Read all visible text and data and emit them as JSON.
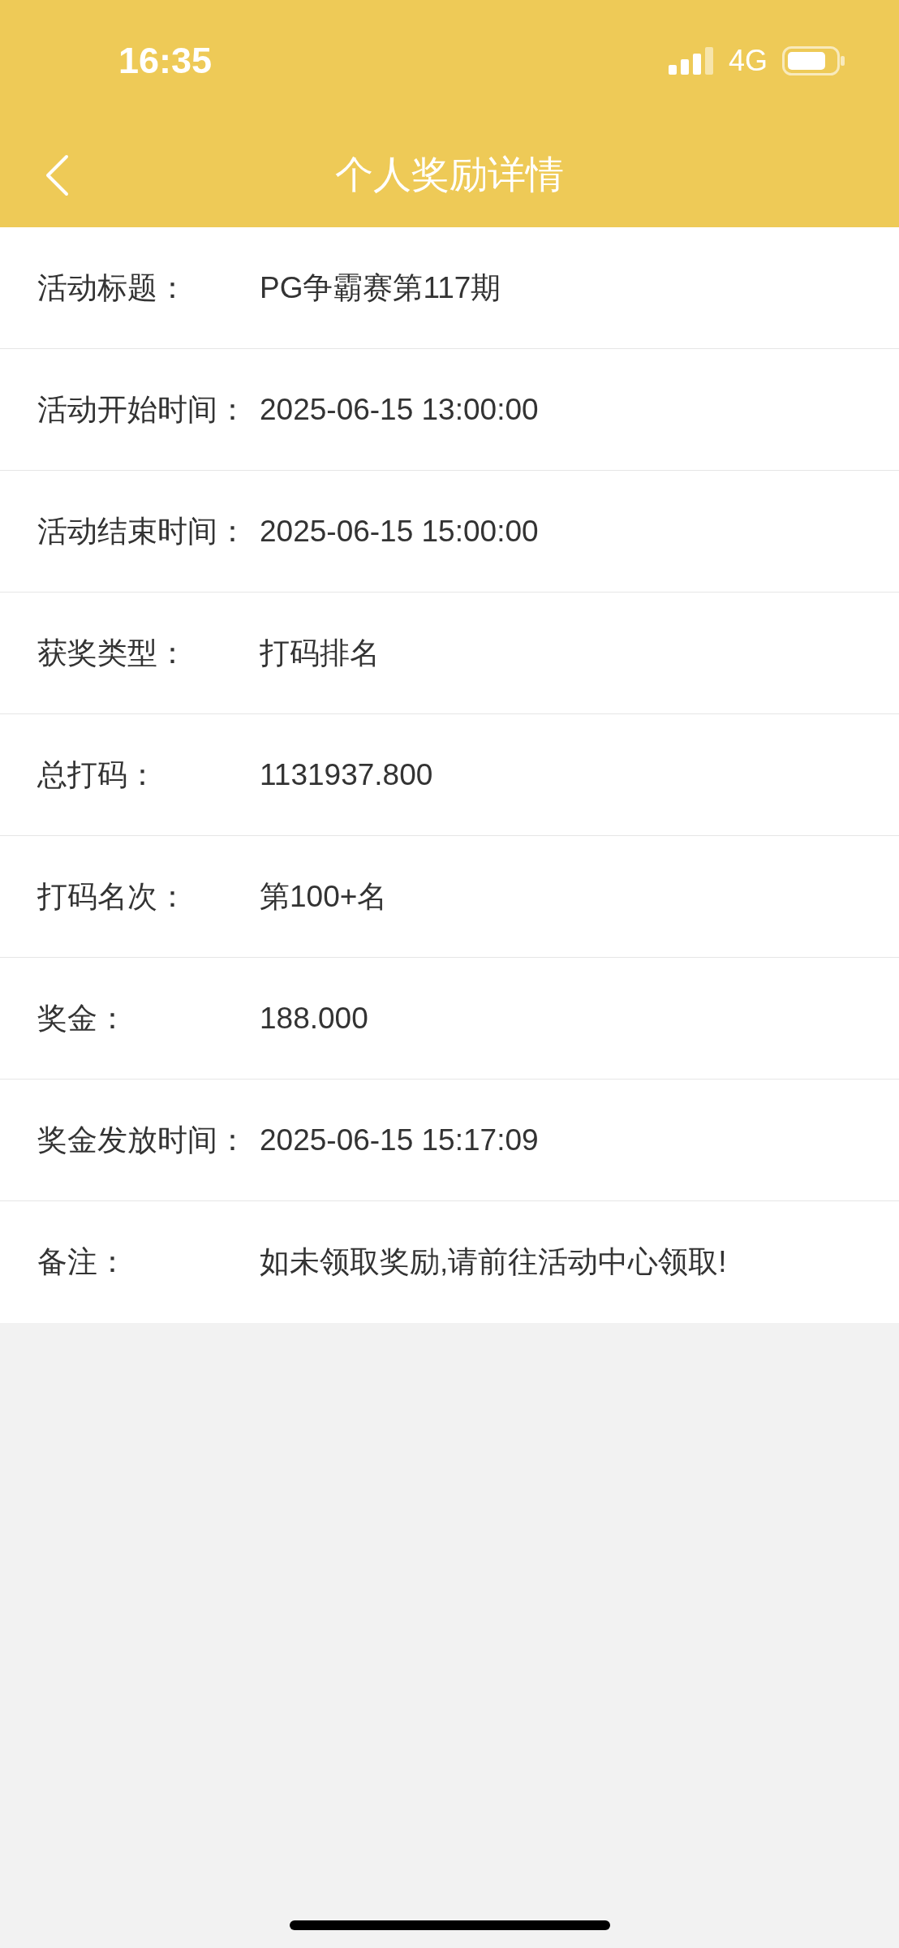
{
  "status_bar": {
    "time": "16:35",
    "network": "4G"
  },
  "nav": {
    "title": "个人奖励详情"
  },
  "rows": [
    {
      "label": "活动标题：",
      "value": "PG争霸赛第117期"
    },
    {
      "label": "活动开始时间：",
      "value": "2025-06-15 13:00:00"
    },
    {
      "label": "活动结束时间：",
      "value": "2025-06-15 15:00:00"
    },
    {
      "label": "获奖类型：",
      "value": "打码排名"
    },
    {
      "label": "总打码：",
      "value": "1131937.800"
    },
    {
      "label": "打码名次：",
      "value": "第100+名"
    },
    {
      "label": "奖金：",
      "value": "188.000"
    },
    {
      "label": "奖金发放时间：",
      "value": "2025-06-15 15:17:09"
    },
    {
      "label": "备注：",
      "value": "如未领取奖励,请前往活动中心领取!"
    }
  ]
}
